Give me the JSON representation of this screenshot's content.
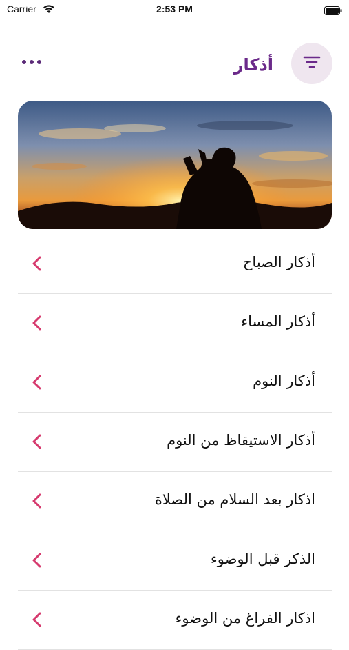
{
  "status_bar": {
    "carrier": "Carrier",
    "time": "2:53 PM"
  },
  "header": {
    "title": "أذكار",
    "menu_icon": "more-dots-icon",
    "filter_icon": "filter-icon"
  },
  "banner": {
    "image": "person-praying-at-sunset"
  },
  "colors": {
    "accent": "#6b2a8a",
    "chevron": "#d63a6e",
    "filter_bg": "#efe6ef",
    "divider": "#e2e2e2"
  },
  "list": {
    "items": [
      {
        "label": "أذكار الصباح"
      },
      {
        "label": "أذكار المساء"
      },
      {
        "label": "أذكار النوم"
      },
      {
        "label": "أذكار الاستيقاظ من النوم"
      },
      {
        "label": "اذكار بعد السلام من الصلاة"
      },
      {
        "label": "الذكر قبل الوضوء"
      },
      {
        "label": "اذكار الفراغ من الوضوء"
      }
    ]
  }
}
